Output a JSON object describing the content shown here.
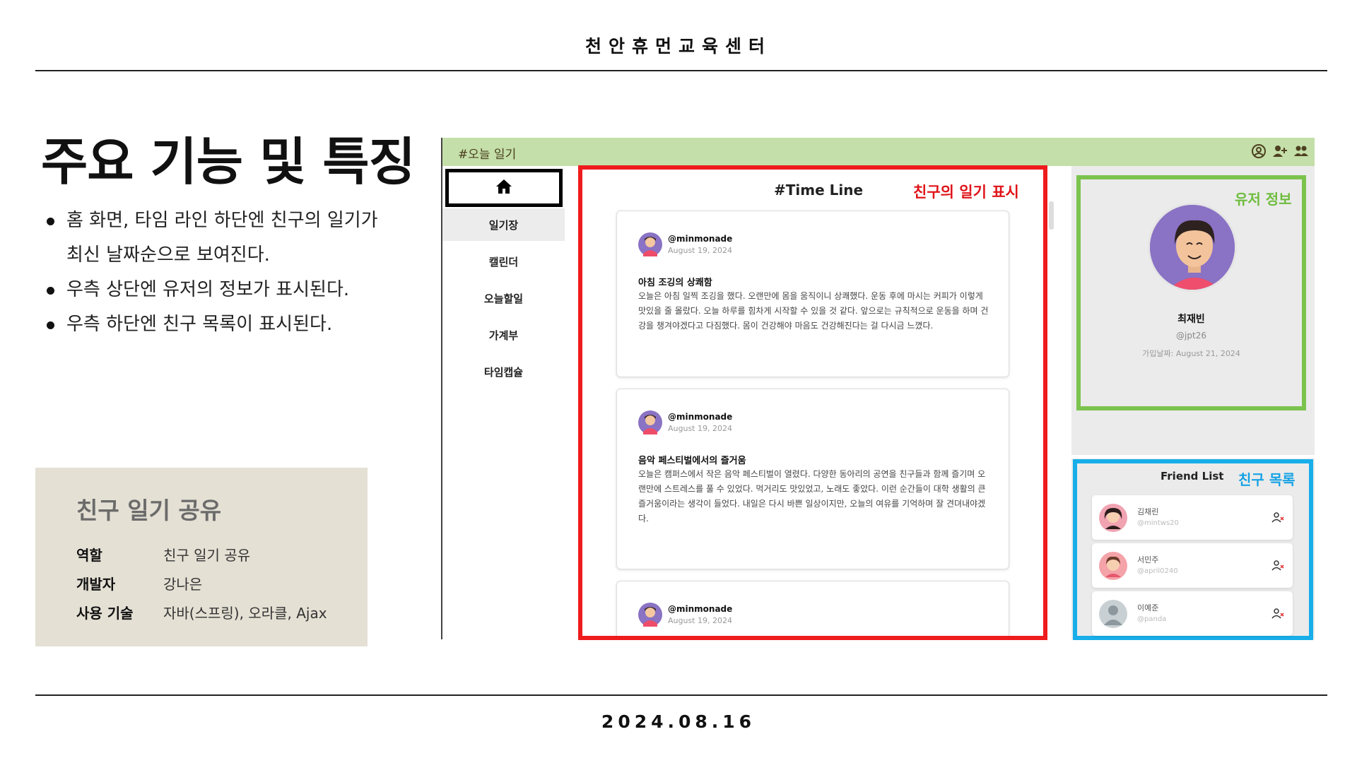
{
  "slide": {
    "org_title": "천안휴먼교육센터",
    "heading": "주요 기능 및 특징",
    "bullets": [
      "홈 화면, 타임 라인 하단엔 친구의 일기가 최신 날짜순으로 보여진다.",
      "우측 상단엔 유저의 정보가 표시된다.",
      "우측 하단엔 친구 목록이 표시된다."
    ],
    "date": "2024.08.16",
    "info": {
      "title": "친구 일기 공유",
      "rows": [
        {
          "key": "역할",
          "value": "친구 일기 공유"
        },
        {
          "key": "개발자",
          "value": "강나은"
        },
        {
          "key": "사용 기술",
          "value": "자바(스프링), 오라클, Ajax"
        }
      ]
    }
  },
  "app": {
    "logo": "#오늘 일기",
    "header_icons": [
      "profile-circle-icon",
      "add-user-icon",
      "users-icon"
    ],
    "sidebar": {
      "home_icon": "home-icon",
      "items": [
        "일기장",
        "캘린더",
        "오늘할일",
        "가계부",
        "타임캡슐"
      ]
    },
    "timeline": {
      "title": "#Time Line",
      "annotation": "친구의 일기 표시",
      "posts": [
        {
          "user": "@minmonade",
          "date": "August 19, 2024",
          "title": "아침 조깅의 상쾌함",
          "body": "오늘은 아침 일찍 조깅을 했다. 오랜만에 몸을 움직이니 상쾌했다. 운동 후에 마시는 커피가 이렇게 맛있을 줄 몰랐다. 오늘 하루를 힘차게 시작할 수 있을 것 같다. 앞으로는 규칙적으로 운동을 하며 건강을 챙겨야겠다고 다짐했다. 몸이 건강해야 마음도 건강해진다는 걸 다시금 느꼈다."
        },
        {
          "user": "@minmonade",
          "date": "August 19, 2024",
          "title": "음악 페스티벌에서의 즐거움",
          "body": "오늘은 캠퍼스에서 작은 음악 페스티벌이 열렸다. 다양한 동아리의 공연을 친구들과 함께 즐기며 오랜만에 스트레스를 풀 수 있었다. 먹거리도 맛있었고, 노래도 좋았다. 이런 순간들이 대학 생활의 큰 즐거움이라는 생각이 들었다. 내일은 다시 바쁜 일상이지만, 오늘의 여유를 기억하며 잘 견뎌내야겠다."
        },
        {
          "user": "@minmonade",
          "date": "August 19, 2024",
          "title": "",
          "body": ""
        }
      ]
    },
    "user_info": {
      "annotation": "유저 정보",
      "name": "최재빈",
      "handle": "@jpt26",
      "joined": "가입날짜: August 21, 2024"
    },
    "friends": {
      "title": "Friend List",
      "annotation": "친구 목록",
      "items": [
        {
          "name": "김채린",
          "handle": "@mintws20"
        },
        {
          "name": "서민주",
          "handle": "@april0240"
        },
        {
          "name": "이예준",
          "handle": "@panda"
        }
      ]
    },
    "colors": {
      "header_green": "#c4dfa9",
      "timeline_frame": "#ee1c1c",
      "user_frame": "#7cc34e",
      "friend_frame": "#17aeea"
    }
  }
}
